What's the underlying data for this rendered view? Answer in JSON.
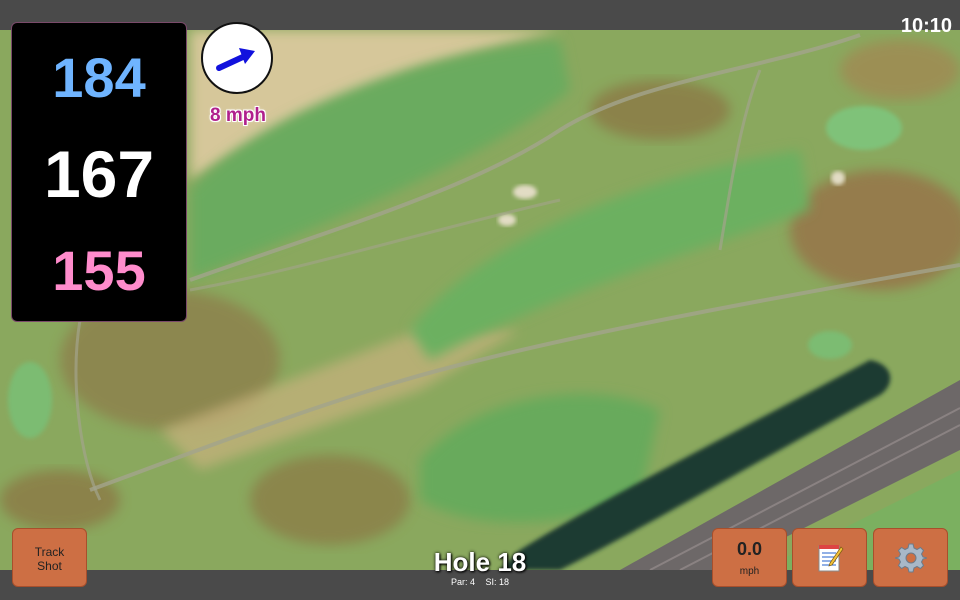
{
  "status_bar": {
    "time": "10:10"
  },
  "distances": {
    "back": "184",
    "middle": "167",
    "front": "155"
  },
  "wind": {
    "speed": "8 mph",
    "direction": "east-northeast",
    "arrow_color": "#1111dd"
  },
  "hole": {
    "title": "Hole 18",
    "par": "Par: 4",
    "stroke_index": "SI: 18"
  },
  "buttons": {
    "track_shot": "Track\nShot",
    "speed_value": "0.0",
    "speed_unit": "mph",
    "notes_icon": "notepad-icon",
    "settings_icon": "gear-icon"
  },
  "colors": {
    "back": "#6fb4ff",
    "middle": "#ffffff",
    "front": "#ff8ccc",
    "button": "#cd6f44",
    "wind_text": "#b0208c"
  }
}
